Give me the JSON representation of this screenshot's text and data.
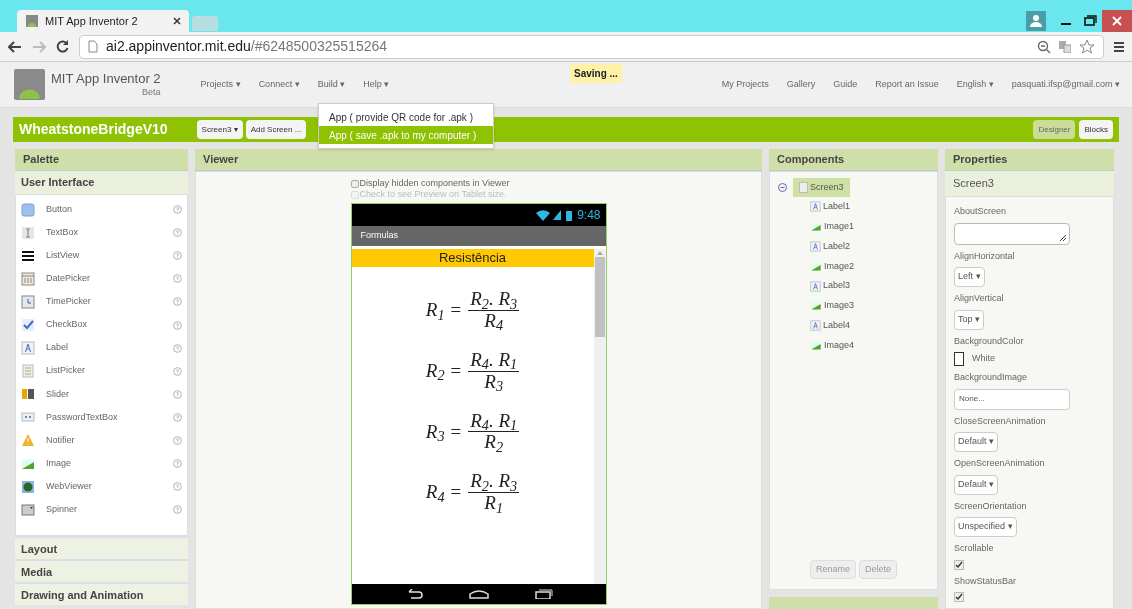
{
  "browser": {
    "tab_title": "MIT App Inventor 2",
    "url_host": "ai2.appinventor.mit.edu",
    "url_path": "/#6248500325515264"
  },
  "app_header": {
    "title": "MIT App Inventor 2",
    "subtitle": "Beta",
    "menus": [
      "Projects ▾",
      "Connect ▾",
      "Build ▾",
      "Help ▾"
    ],
    "saving": "Saving ...",
    "links": [
      "My Projects",
      "Gallery",
      "Guide",
      "Report an Issue",
      "English ▾",
      "pasquati.ifsp@gmail.com ▾"
    ]
  },
  "project_bar": {
    "name": "WheatstoneBridgeV10",
    "screen_button": "Screen3 ▾",
    "add_screen_button": "Add Screen ...",
    "modes": [
      {
        "label": "Designer",
        "selected": true
      },
      {
        "label": "Blocks",
        "selected": false
      }
    ]
  },
  "build_menu": [
    {
      "label": "App ( provide QR code for .apk )",
      "selected": false
    },
    {
      "label": "App ( save .apk to my computer )",
      "selected": true
    }
  ],
  "palette": {
    "title": "Palette",
    "groups": [
      {
        "label": "User Interface",
        "expanded": true,
        "items": [
          {
            "label": "Button",
            "kind": "button"
          },
          {
            "label": "TextBox",
            "kind": "textbox"
          },
          {
            "label": "ListView",
            "kind": "listview"
          },
          {
            "label": "DatePicker",
            "kind": "datepicker"
          },
          {
            "label": "TimePicker",
            "kind": "timepicker"
          },
          {
            "label": "CheckBox",
            "kind": "checkbox"
          },
          {
            "label": "Label",
            "kind": "label"
          },
          {
            "label": "ListPicker",
            "kind": "listpicker"
          },
          {
            "label": "Slider",
            "kind": "slider"
          },
          {
            "label": "PasswordTextBox",
            "kind": "password"
          },
          {
            "label": "Notifier",
            "kind": "notifier"
          },
          {
            "label": "Image",
            "kind": "image"
          },
          {
            "label": "WebViewer",
            "kind": "webviewer"
          },
          {
            "label": "Spinner",
            "kind": "spinner"
          }
        ]
      },
      {
        "label": "Layout",
        "expanded": false
      },
      {
        "label": "Media",
        "expanded": false
      },
      {
        "label": "Drawing and Animation",
        "expanded": false
      }
    ]
  },
  "viewer": {
    "title": "Viewer",
    "options": [
      {
        "label": "Display hidden components in Viewer",
        "checked": false,
        "disabled": false
      },
      {
        "label": "Check to see Preview on Tablet size.",
        "checked": false,
        "disabled": true
      }
    ],
    "phone": {
      "time": "9:48",
      "title": "Formulas",
      "header": "Resistência",
      "formulas": [
        {
          "lhs": "R$_{1}$ =",
          "numerator": "R$_{2}$. R$_{3}$",
          "denominator": "R$_{4}$"
        },
        {
          "lhs": "R$_{2}$ =",
          "numerator": "R$_{4}$. R$_{1}$",
          "denominator": "R$_{3}$"
        },
        {
          "lhs": "R$_{3}$ =",
          "numerator": "R$_{4}$. R$_{1}$",
          "denominator": "R$_{2}$"
        },
        {
          "lhs": "R$_{4}$ =",
          "numerator": "R$_{2}$. R$_{3}$",
          "denominator": "R$_{1}$"
        }
      ]
    }
  },
  "components": {
    "title": "Components",
    "tree": {
      "label": "Screen3",
      "selected": true,
      "expanded": true,
      "children": [
        {
          "label": "Label1",
          "kind": "label"
        },
        {
          "label": "Image1",
          "kind": "image"
        },
        {
          "label": "Label2",
          "kind": "label"
        },
        {
          "label": "Image2",
          "kind": "image"
        },
        {
          "label": "Label3",
          "kind": "label"
        },
        {
          "label": "Image3",
          "kind": "image"
        },
        {
          "label": "Label4",
          "kind": "label"
        },
        {
          "label": "Image4",
          "kind": "image"
        }
      ]
    },
    "buttons": [
      "Rename",
      "Delete"
    ]
  },
  "properties": {
    "title": "Properties",
    "component": "Screen3",
    "items": [
      {
        "label": "AboutScreen",
        "kind": "textarea"
      },
      {
        "label": "AlignHorizontal",
        "kind": "dropdown",
        "value": "Left ▾"
      },
      {
        "label": "AlignVertical",
        "kind": "dropdown",
        "value": "Top ▾"
      },
      {
        "label": "BackgroundColor",
        "kind": "color",
        "value": "White",
        "color": "#ffffff"
      },
      {
        "label": "BackgroundImage",
        "kind": "text",
        "value": "None..."
      },
      {
        "label": "CloseScreenAnimation",
        "kind": "dropdown",
        "value": "Default ▾"
      },
      {
        "label": "OpenScreenAnimation",
        "kind": "dropdown",
        "value": "Default ▾"
      },
      {
        "label": "ScreenOrientation",
        "kind": "dropdown",
        "value": "Unspecified ▾"
      },
      {
        "label": "Scrollable",
        "kind": "checkbox",
        "checked": true
      },
      {
        "label": "ShowStatusBar",
        "kind": "checkbox",
        "checked": true
      }
    ]
  }
}
